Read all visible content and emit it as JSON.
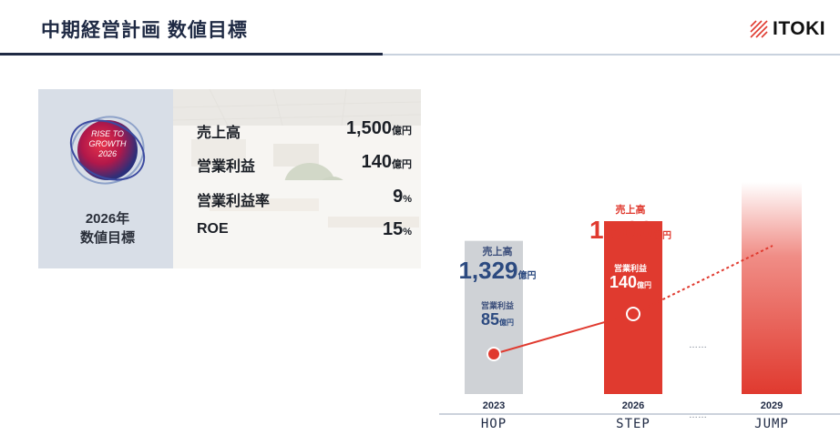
{
  "header": {
    "title": "中期経営計画 数値目標",
    "brand": "ITOKI",
    "accent_dark": "#1f2a44",
    "accent_red": "#e03a2f"
  },
  "target": {
    "badge_lines": [
      "RISE TO",
      "GROWTH",
      "2026"
    ],
    "year_label_1": "2026年",
    "year_label_2": "数値目標",
    "metrics": [
      {
        "name": "売上高",
        "value": "1,500",
        "unit": "億円"
      },
      {
        "name": "営業利益",
        "value": "140",
        "unit": "億円"
      },
      {
        "name": "営業利益率",
        "value": "9",
        "unit": "%"
      },
      {
        "name": "ROE",
        "value": "15",
        "unit": "%"
      }
    ]
  },
  "chart_data": {
    "type": "bar",
    "categories": [
      "2023",
      "2026",
      "2029"
    ],
    "phases": [
      "HOP",
      "STEP",
      "JUMP"
    ],
    "gap_marker": "……",
    "series": [
      {
        "name": "売上高",
        "unit": "億円",
        "values": [
          1329,
          1500,
          null
        ]
      },
      {
        "name": "営業利益",
        "unit": "億円",
        "values": [
          85,
          140,
          null
        ]
      }
    ],
    "labels": {
      "sales_name": "売上高",
      "op_name": "営業利益",
      "unit": "億円",
      "sales_2023": "1,329",
      "sales_2026": "1,500",
      "op_2023": "85",
      "op_2026": "140"
    },
    "colors": {
      "2023": "#cfd2d6",
      "2026": "#e03a2f",
      "2029": "#f08d86",
      "line": "#e03a2f"
    }
  }
}
